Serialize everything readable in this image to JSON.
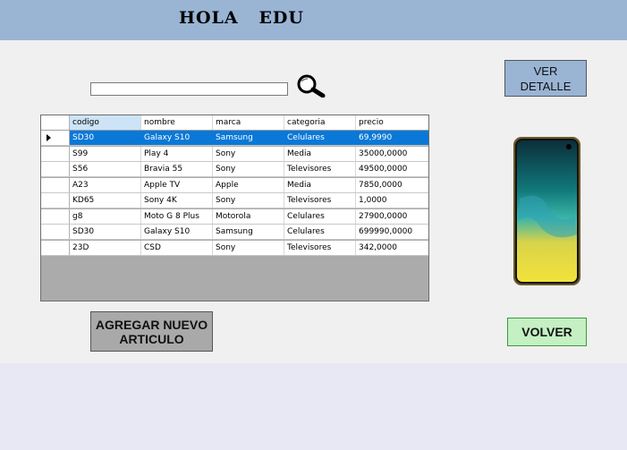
{
  "header": {
    "title": "HOLA   EDU"
  },
  "search": {
    "value": "",
    "icon": "magnifier-icon"
  },
  "buttons": {
    "ver_detalle": "VER DETALLE",
    "agregar": "AGREGAR NUEVO ARTICULO",
    "volver": "VOLVER"
  },
  "grid": {
    "columns": [
      "codigo",
      "nombre",
      "marca",
      "categoria",
      "precio"
    ],
    "selected_row": 0,
    "rows": [
      [
        "SD30",
        "Galaxy S10",
        "Samsung",
        "Celulares",
        "69,9990"
      ],
      [
        "S99",
        "Play 4",
        "Sony",
        "Media",
        "35000,0000"
      ],
      [
        "S56",
        "Bravia 55",
        "Sony",
        "Televisores",
        "49500,0000"
      ],
      [
        "A23",
        "Apple TV",
        "Apple",
        "Media",
        "7850,0000"
      ],
      [
        "KD65",
        "Sony 4K",
        "Sony",
        "Televisores",
        "1,0000"
      ],
      [
        "g8",
        "Moto G 8 Plus",
        "Motorola",
        "Celulares",
        "27900,0000"
      ],
      [
        "SD30",
        "Galaxy S10",
        "Samsung",
        "Celulares",
        "699990,0000"
      ],
      [
        "23D",
        "CSD",
        "Sony",
        "Televisores",
        "342,0000"
      ]
    ]
  },
  "preview": {
    "image": "smartphone-image"
  },
  "colors": {
    "header_bg": "#9ab4d4",
    "selection": "#0a78d7",
    "volver_bg": "#c4f0c4",
    "agregar_bg": "#a9a9a9"
  }
}
